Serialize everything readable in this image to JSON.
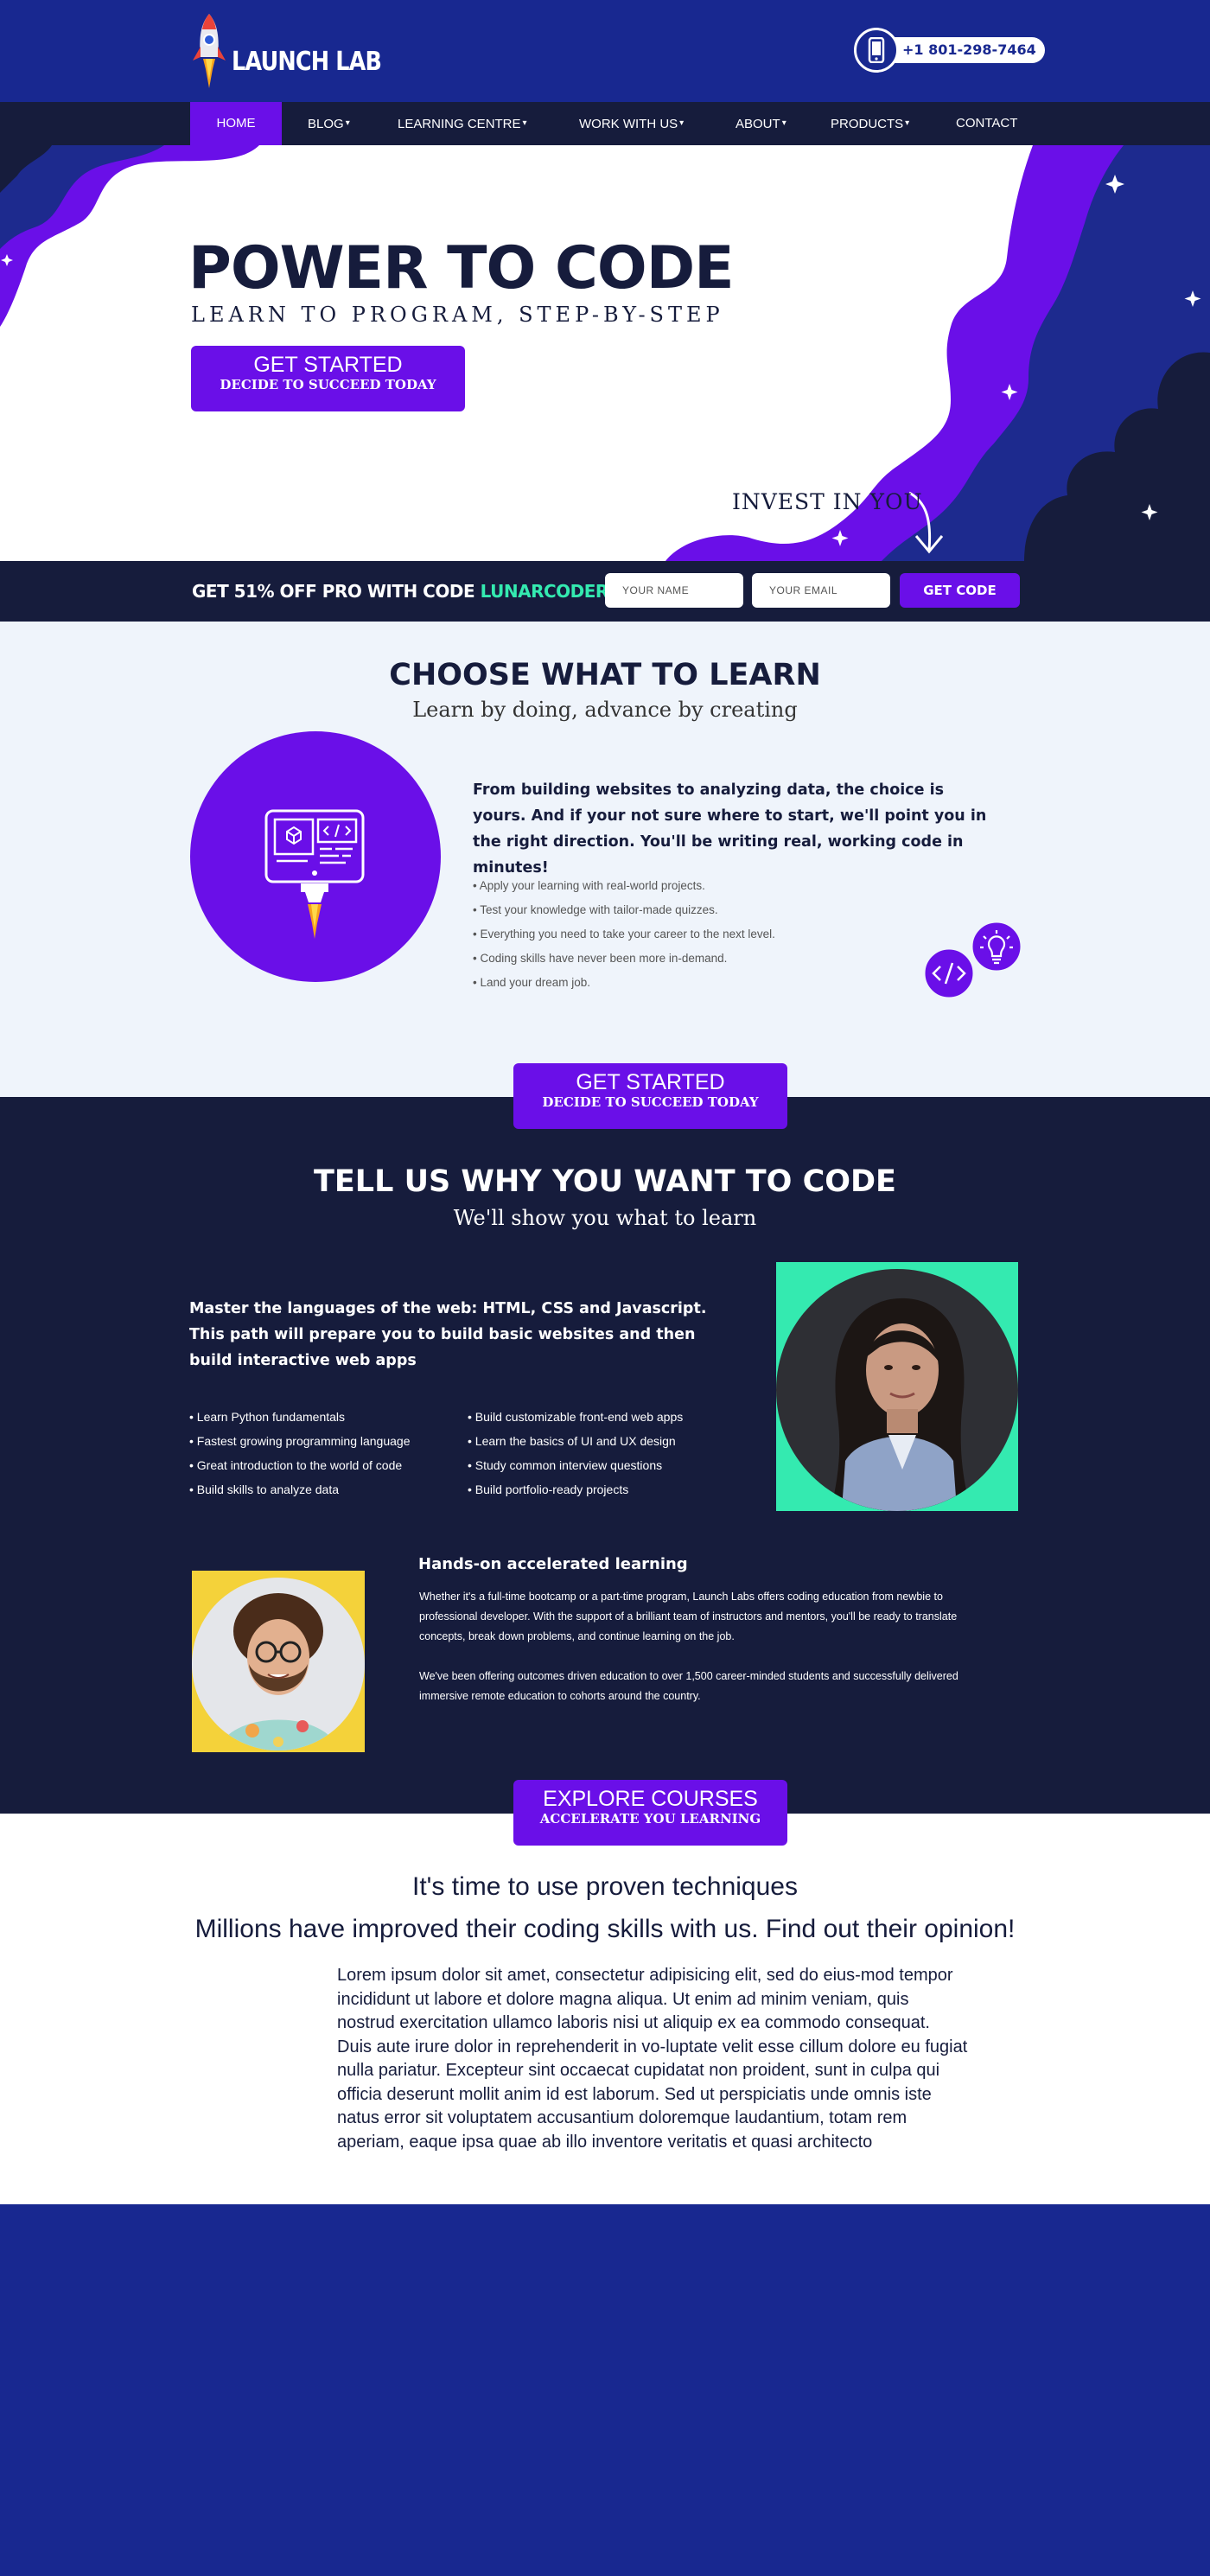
{
  "header": {
    "logo_text": "LAUNCH LAB",
    "phone": "+1 801-298-7464"
  },
  "nav": {
    "items": [
      {
        "label": "HOME",
        "dropdown": false,
        "active": true
      },
      {
        "label": "BLOG",
        "dropdown": true
      },
      {
        "label": "LEARNING CENTRE",
        "dropdown": true
      },
      {
        "label": "WORK WITH US",
        "dropdown": true
      },
      {
        "label": "ABOUT",
        "dropdown": true
      },
      {
        "label": "PRODUCTS",
        "dropdown": true
      },
      {
        "label": "CONTACT",
        "dropdown": false
      }
    ],
    "caret": "▾"
  },
  "hero": {
    "title": "POWER TO CODE",
    "subtitle": "LEARN TO PROGRAM, STEP-BY-STEP",
    "cta_line1": "GET STARTED",
    "cta_line2": "DECIDE TO SUCCEED TODAY",
    "invest": "INVEST IN YOU"
  },
  "promo": {
    "text": "GET 51% OFF PRO WITH CODE ",
    "code": "LUNARCODER",
    "name_placeholder": "YOUR NAME",
    "email_placeholder": "YOUR EMAIL",
    "button": "GET CODE"
  },
  "choose": {
    "title": "CHOOSE WHAT TO LEARN",
    "subtitle": "Learn by doing, advance by creating",
    "lead": "From building websites to analyzing data, the choice is yours. And if your not sure where to start, we'll point you in the right direction. You'll be writing real, working code in minutes!",
    "bullets": [
      "• Apply your learning with real-world projects.",
      "• Test your knowledge with tailor-made quizzes.",
      "• Everything you need to take your career to the next level.",
      "• Coding skills have never been more in-demand.",
      "• Land your dream job."
    ],
    "cta_line1": "GET STARTED",
    "cta_line2": "DECIDE TO SUCCEED TODAY"
  },
  "why": {
    "title": "TELL US WHY YOU WANT TO CODE",
    "subtitle": "We'll show you what to learn",
    "lead": "Master the languages of the web: HTML, CSS and Javascript. This path will prepare you to build basic websites and then build interactive web apps",
    "bullets_left": [
      "• Learn Python fundamentals",
      "• Fastest growing programming language",
      "• Great introduction to the world of code",
      "• Build skills to analyze data"
    ],
    "bullets_right": [
      "• Build customizable front-end web apps",
      "• Learn the basics of UI and UX design",
      "• Study common interview questions",
      "• Build portfolio-ready projects"
    ],
    "hands_title": "Hands-on accelerated learning",
    "para1": "Whether it's a full-time bootcamp or a part-time program, Launch Labs offers coding education from newbie to professional developer. With the support of a brilliant team of instructors and mentors, you'll be ready to translate concepts, break down problems, and continue learning on the job.",
    "para2": "We've been offering outcomes driven education to over 1,500 career-minded students and successfully delivered immersive remote education to cohorts around the country.",
    "cta_line1": "EXPLORE COURSES",
    "cta_line2": "ACCELERATE YOU LEARNING"
  },
  "testimonials": {
    "heading1": "It's time to use proven techniques",
    "heading2": "Millions have improved their coding skills with us. Find out their opinion!",
    "lorem": "Lorem ipsum dolor sit amet, consectetur adipisicing elit, sed do eius-mod tempor incididunt ut labore et dolore magna aliqua. Ut enim ad minim veniam, quis nostrud exercitation ullamco laboris nisi ut aliquip ex ea commodo consequat. Duis aute irure dolor in reprehenderit in vo-luptate velit esse cillum dolore eu fugiat nulla pariatur. Excepteur sint occaecat cupidatat non proident, sunt in culpa qui officia deserunt mollit anim id est laborum. Sed ut perspiciatis unde omnis iste natus error sit voluptatem accusantium doloremque laudantium, totam rem aperiam, eaque ipsa quae ab illo inventore veritatis et quasi architecto"
  },
  "colors": {
    "brand_blue": "#182890",
    "navy": "#161c3c",
    "purple": "#6a0fe8",
    "mint": "#34eab0",
    "light_bg": "#eff4fb",
    "yellow": "#f4d23a"
  }
}
